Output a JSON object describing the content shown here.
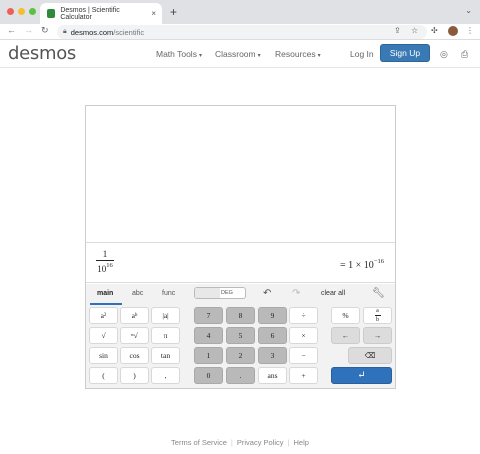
{
  "browser": {
    "tab_title": "Desmos | Scientific Calculator",
    "tab_close": "×",
    "new_tab": "+",
    "tab_menu": "⌄",
    "address_host": "desmos.com",
    "address_path": "/scientific",
    "icons": [
      "back-icon",
      "forward-icon",
      "reload-icon",
      "lock-icon",
      "share-icon",
      "star-icon",
      "extension-icon",
      "menu-icon"
    ],
    "traffic_lights": [
      "#ee5f57",
      "#f5bd2f",
      "#5bc240"
    ]
  },
  "header": {
    "logo": "desmos",
    "nav": [
      {
        "label": "Math Tools",
        "caret": "▾"
      },
      {
        "label": "Classroom",
        "caret": "▾"
      },
      {
        "label": "Resources",
        "caret": "▾"
      }
    ],
    "login": "Log In",
    "signup": "Sign Up",
    "accent": "#3a7ab4"
  },
  "calculator": {
    "expression": {
      "numerator": "1",
      "base": "10",
      "exponent": "16"
    },
    "result": {
      "prefix": "= 1 ×",
      "base": "10",
      "exponent": "−16"
    },
    "tabs": [
      {
        "label": "main",
        "active": true
      },
      {
        "label": "abc",
        "active": false
      },
      {
        "label": "func",
        "active": false
      }
    ],
    "angle_mode": "DEG",
    "clear_all": "clear all",
    "keys": {
      "a2": {
        "base": "a",
        "sup": "2"
      },
      "ab": {
        "base": "a",
        "sup": "b"
      },
      "abs": "|a|",
      "sqrt": "√",
      "nroot": "ⁿ√",
      "pi": "π",
      "sin": "sin",
      "cos": "cos",
      "tan": "tan",
      "lparen": "(",
      "rparen": ")",
      "comma": ",",
      "d7": "7",
      "d8": "8",
      "d9": "9",
      "d4": "4",
      "d5": "5",
      "d6": "6",
      "d1": "1",
      "d2": "2",
      "d3": "3",
      "d0": "0",
      "dot": ".",
      "ans": "ans",
      "div": "÷",
      "mul": "×",
      "sub": "−",
      "add": "+",
      "percent": "%",
      "frac": {
        "num": "a",
        "den": "b"
      },
      "left": "←",
      "right": "→",
      "backspace": "⌫",
      "enter": "↵"
    }
  },
  "footer": {
    "links": [
      "Terms of Service",
      "Privacy Policy",
      "Help"
    ]
  }
}
